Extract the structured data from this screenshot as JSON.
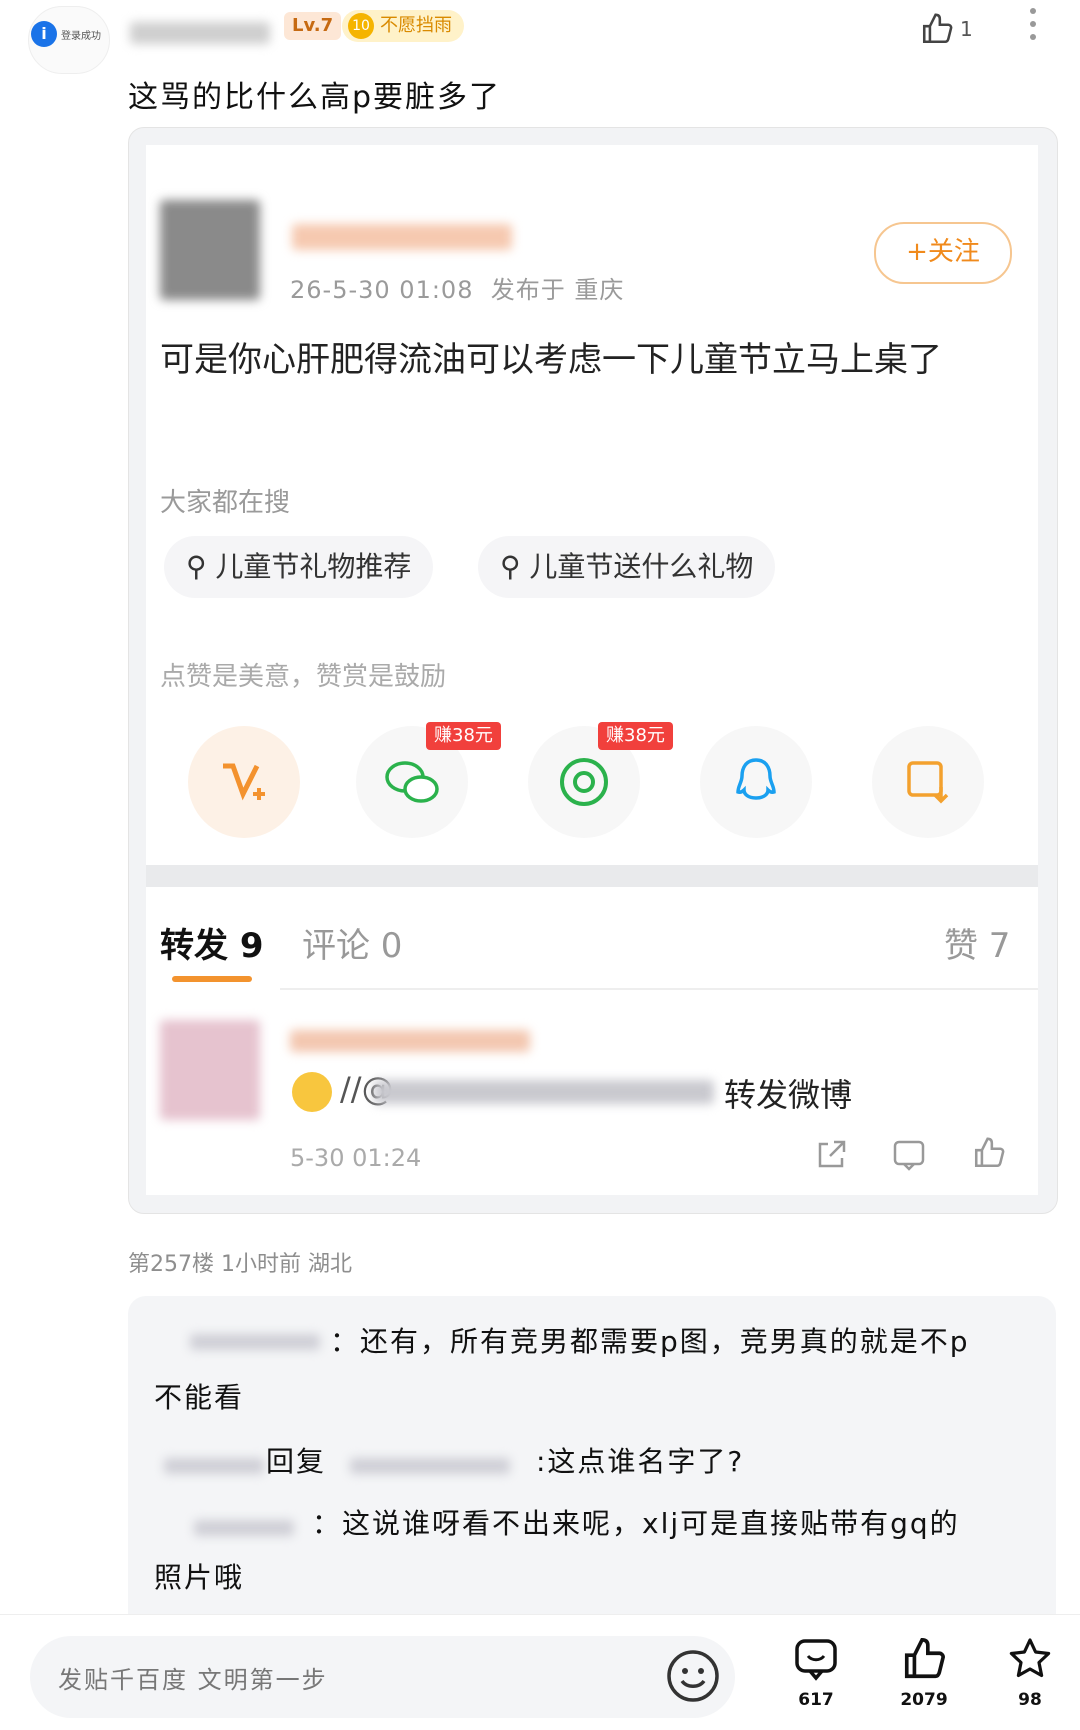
{
  "header": {
    "avatar_label": "登录成功",
    "level": "Lv.7",
    "medal_number": "10",
    "medal_text": "不愿挡雨",
    "like_count": "1"
  },
  "comment": {
    "text": "这骂的比什么高p要脏多了"
  },
  "quoted": {
    "follow_label": "+关注",
    "date": "26-5-30 01:08",
    "location": "发布于 重庆",
    "post_text": "可是你心肝肥得流油可以考虑一下儿童节立马上桌了",
    "hot_label": "大家都在搜",
    "chips": [
      "儿童节礼物推荐",
      "儿童节送什么礼物"
    ],
    "praise_text": "点赞是美意，赞赏是鼓励",
    "badges": [
      "赚38元",
      "赚38元"
    ],
    "tabs": {
      "repost": "转发 9",
      "comment": "评论 0",
      "like": "赞 7"
    },
    "repost_row": {
      "text": "转发微博",
      "prefix": "//@",
      "date": "5-30 01:24"
    }
  },
  "floor_info": "第257楼 1小时前 湖北",
  "replies": [
    {
      "text": "：还有，所有竞男都需要p图，竞男真的就是不p"
    },
    {
      "text": "不能看"
    },
    {
      "text": "回复"
    },
    {
      "text": ":这点谁名字了?"
    },
    {
      "text": "：这说谁呀看不出来呢，xlj可是直接贴带有gq的"
    },
    {
      "text": "照片哦"
    }
  ],
  "bottom_bar": {
    "placeholder": "发贴千百度 文明第一步",
    "comments": "617",
    "likes": "2079",
    "favorites": "98"
  },
  "icons": [
    "info-icon",
    "thumb-up-icon",
    "more-icon",
    "search-icon",
    "vip-icon",
    "wechat-icon",
    "moments-icon",
    "qq-icon",
    "save-image-icon",
    "share-icon",
    "comment-icon",
    "emoji-icon",
    "star-icon"
  ],
  "colors": {
    "accent": "#f08a1c",
    "level_bg": "#fde7d6",
    "badge_red": "#f1403c"
  }
}
